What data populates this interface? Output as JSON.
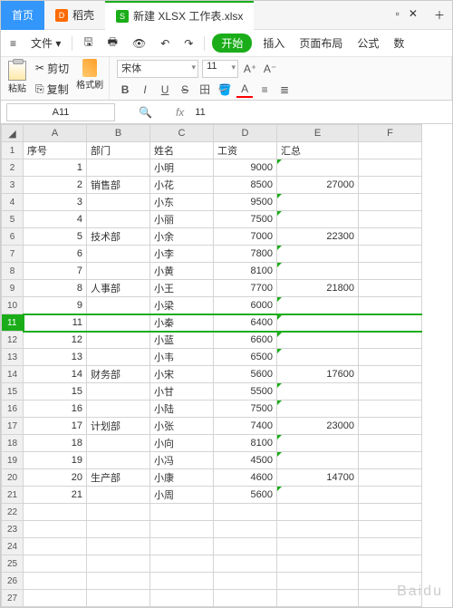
{
  "tabs": {
    "home": "首页",
    "dao": "稻壳",
    "file": "新建 XLSX 工作表.xlsx"
  },
  "menu": {
    "file": "文件",
    "start": "开始",
    "insert": "插入",
    "layout": "页面布局",
    "formula": "公式",
    "data": "数"
  },
  "tb": {
    "cut": "剪切",
    "copy": "复制",
    "paste": "粘贴",
    "format": "格式刷",
    "font": "宋体",
    "size": "11"
  },
  "nb": {
    "cell": "A11",
    "fx": "fx",
    "formula": "11"
  },
  "cols": [
    "A",
    "B",
    "C",
    "D",
    "E",
    "F"
  ],
  "headers": {
    "a": "序号",
    "b": "部门",
    "c": "姓名",
    "d": "工资",
    "e": "汇总"
  },
  "rows": [
    {
      "n": 1,
      "a": "1",
      "b": "",
      "c": "小明",
      "d": "9000",
      "e": ""
    },
    {
      "n": 2,
      "a": "2",
      "b": "销售部",
      "c": "小花",
      "d": "8500",
      "e": "27000"
    },
    {
      "n": 3,
      "a": "3",
      "b": "",
      "c": "小东",
      "d": "9500",
      "e": ""
    },
    {
      "n": 4,
      "a": "4",
      "b": "",
      "c": "小丽",
      "d": "7500",
      "e": ""
    },
    {
      "n": 5,
      "a": "5",
      "b": "技术部",
      "c": "小余",
      "d": "7000",
      "e": "22300"
    },
    {
      "n": 6,
      "a": "6",
      "b": "",
      "c": "小李",
      "d": "7800",
      "e": ""
    },
    {
      "n": 7,
      "a": "7",
      "b": "",
      "c": "小黄",
      "d": "8100",
      "e": ""
    },
    {
      "n": 8,
      "a": "8",
      "b": "人事部",
      "c": "小王",
      "d": "7700",
      "e": "21800"
    },
    {
      "n": 9,
      "a": "9",
      "b": "",
      "c": "小梁",
      "d": "6000",
      "e": ""
    },
    {
      "n": 10,
      "a": "11",
      "b": "",
      "c": "小秦",
      "d": "6400",
      "e": "",
      "sel": true
    },
    {
      "n": 11,
      "a": "12",
      "b": "",
      "c": "小蓝",
      "d": "6600",
      "e": ""
    },
    {
      "n": 12,
      "a": "13",
      "b": "",
      "c": "小韦",
      "d": "6500",
      "e": ""
    },
    {
      "n": 13,
      "a": "14",
      "b": "财务部",
      "c": "小宋",
      "d": "5600",
      "e": "17600"
    },
    {
      "n": 14,
      "a": "15",
      "b": "",
      "c": "小甘",
      "d": "5500",
      "e": ""
    },
    {
      "n": 15,
      "a": "16",
      "b": "",
      "c": "小陆",
      "d": "7500",
      "e": ""
    },
    {
      "n": 16,
      "a": "17",
      "b": "计划部",
      "c": "小张",
      "d": "7400",
      "e": "23000"
    },
    {
      "n": 17,
      "a": "18",
      "b": "",
      "c": "小向",
      "d": "8100",
      "e": ""
    },
    {
      "n": 18,
      "a": "19",
      "b": "",
      "c": "小冯",
      "d": "4500",
      "e": ""
    },
    {
      "n": 19,
      "a": "20",
      "b": "生产部",
      "c": "小康",
      "d": "4600",
      "e": "14700"
    },
    {
      "n": 20,
      "a": "21",
      "b": "",
      "c": "小周",
      "d": "5600",
      "e": ""
    }
  ],
  "rowNums": [
    1,
    2,
    3,
    4,
    5,
    6,
    7,
    8,
    9,
    10,
    11,
    12,
    13,
    14,
    15,
    16,
    17,
    18,
    19,
    20,
    21,
    22,
    23,
    24,
    25,
    26,
    27
  ]
}
